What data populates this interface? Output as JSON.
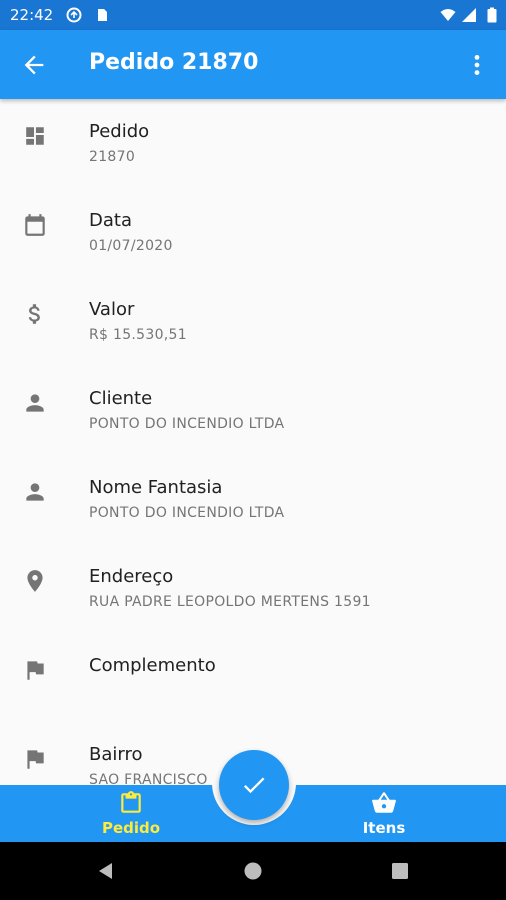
{
  "status_bar": {
    "time": "22:42"
  },
  "app_bar": {
    "title": "Pedido 21870"
  },
  "details": [
    {
      "icon": "dashboard-icon",
      "label": "Pedido",
      "value": "21870"
    },
    {
      "icon": "calendar-icon",
      "label": "Data",
      "value": "01/07/2020"
    },
    {
      "icon": "dollar-icon",
      "label": "Valor",
      "value": "R$ 15.530,51"
    },
    {
      "icon": "person-icon",
      "label": "Cliente",
      "value": "PONTO DO INCENDIO LTDA"
    },
    {
      "icon": "person-icon",
      "label": "Nome Fantasia",
      "value": "PONTO DO INCENDIO LTDA"
    },
    {
      "icon": "location-pin-icon",
      "label": "Endereço",
      "value": "RUA PADRE LEOPOLDO MERTENS 1591"
    },
    {
      "icon": "flag-icon",
      "label": "Complemento",
      "value": ""
    },
    {
      "icon": "flag-icon",
      "label": "Bairro",
      "value": "SAO FRANCISCO"
    }
  ],
  "bottom_nav": {
    "pedido_label": "Pedido",
    "itens_label": "Itens",
    "active_color": "#ffeb3b",
    "inactive_color": "#ffffff"
  },
  "fab": {
    "icon": "check-icon"
  },
  "colors": {
    "primary": "#2196f3",
    "primary_dark": "#1976d2",
    "background": "#fafafa"
  }
}
